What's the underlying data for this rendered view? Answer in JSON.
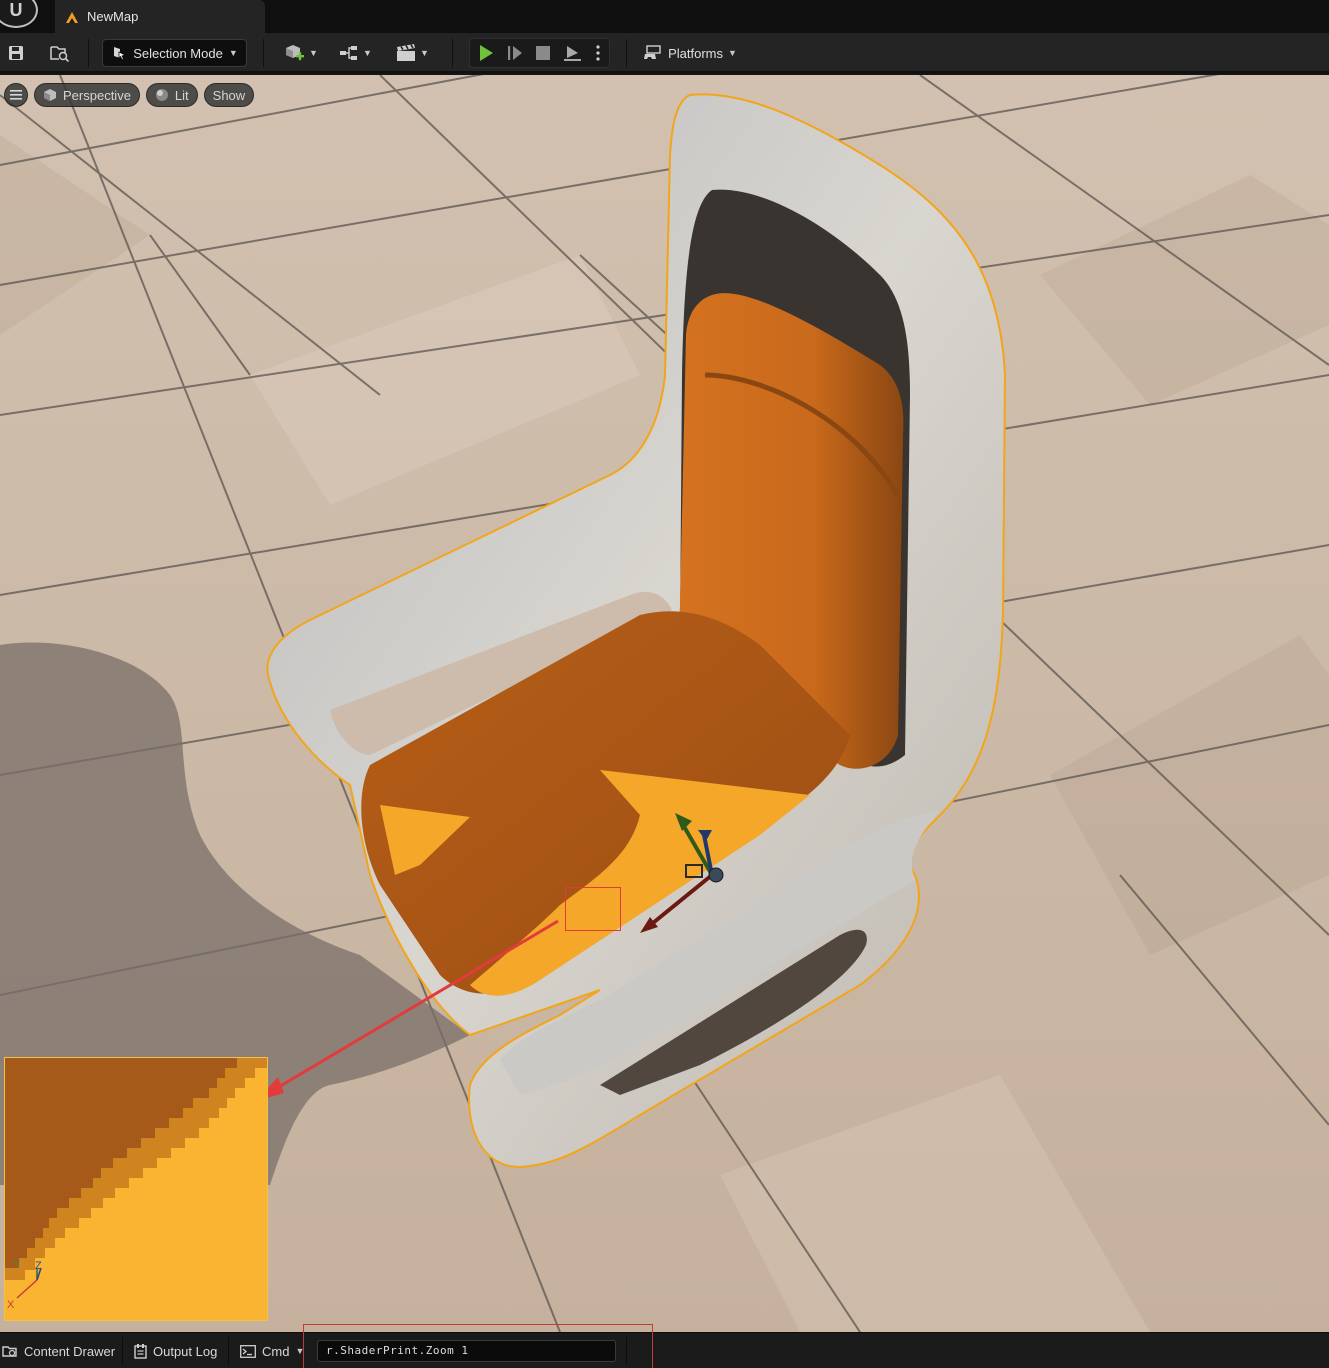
{
  "app": {
    "map_tab_label": "NewMap"
  },
  "toolbar": {
    "selection_mode_label": "Selection Mode",
    "platforms_label": "Platforms"
  },
  "viewport": {
    "perspective_label": "Perspective",
    "lit_label": "Lit",
    "show_label": "Show",
    "axis_labels": {
      "x": "X",
      "y": "Y",
      "z": "Z"
    }
  },
  "bottom_bar": {
    "content_drawer_label": "Content Drawer",
    "output_log_label": "Output Log",
    "cmd_label": "Cmd",
    "cmd_value": "r.ShaderPrint.Zoom 1"
  },
  "colors": {
    "selection_outline": "#f2a51a",
    "seat_orange": "#c86d1e",
    "seat_lit": "#f5a72a",
    "frame_white": "#d9d6d0",
    "floor": "#c9b6a3",
    "marker_red": "#e23b3b",
    "play_green": "#6fc23a"
  },
  "icons": {
    "save": "save-icon",
    "browse": "browse-icon",
    "add_actor": "add-actor-icon",
    "blueprint": "blueprint-icon",
    "cinematics": "clapperboard-icon",
    "play": "play-icon",
    "step": "step-icon",
    "stop": "stop-icon",
    "eject": "eject-icon",
    "more": "more-vertical-icon",
    "platforms": "gamepad-icon",
    "hamburger": "menu-icon",
    "perspective": "cube-icon",
    "lit": "lit-sphere-icon",
    "content_drawer": "content-drawer-icon",
    "output_log": "output-log-icon",
    "cmd": "terminal-icon"
  }
}
